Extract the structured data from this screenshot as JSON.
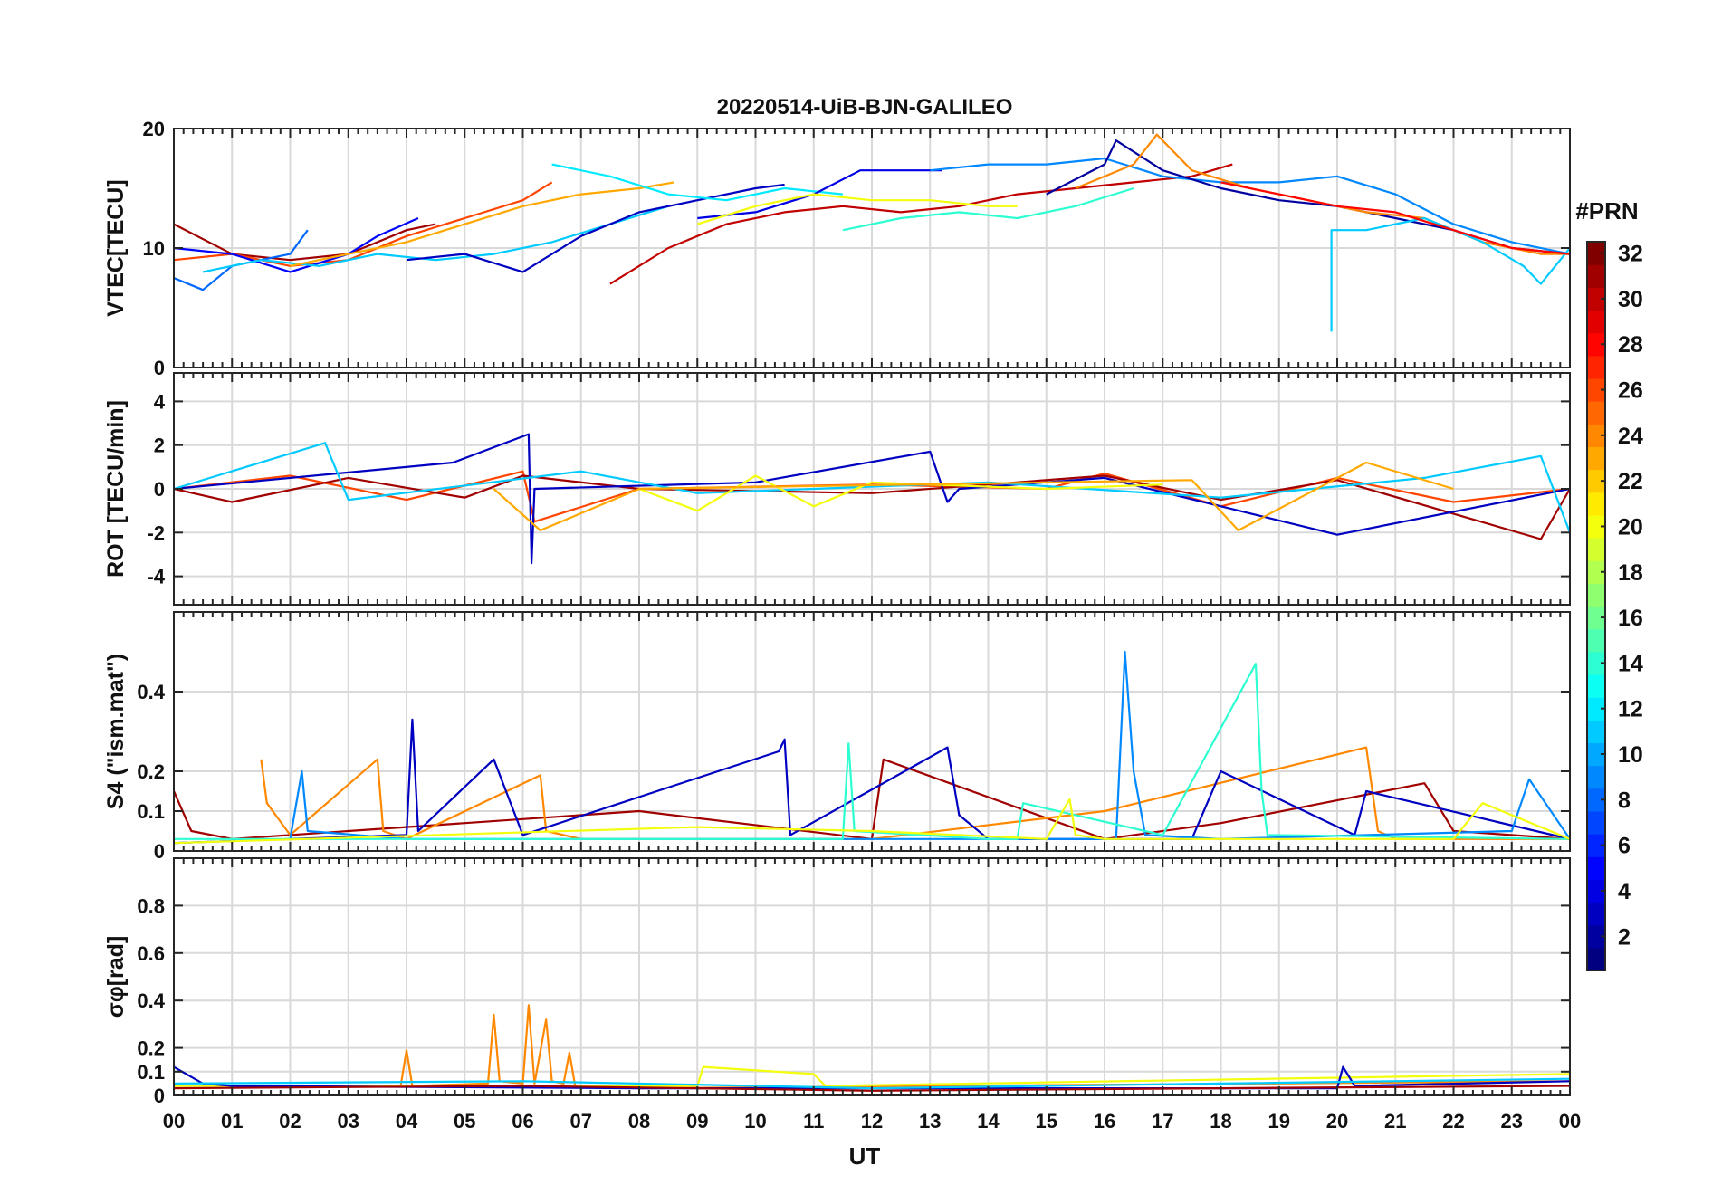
{
  "figure_title": "20220514-UiB-BJN-GALILEO",
  "x_axis": {
    "label": "UT",
    "ticks": [
      "00",
      "01",
      "02",
      "03",
      "04",
      "05",
      "06",
      "07",
      "08",
      "09",
      "10",
      "11",
      "12",
      "13",
      "14",
      "15",
      "16",
      "17",
      "18",
      "19",
      "20",
      "21",
      "22",
      "23",
      "00"
    ],
    "range": [
      0,
      24
    ]
  },
  "colorbar": {
    "title": "#PRN",
    "range": [
      1,
      32
    ],
    "ticks": [
      2,
      4,
      6,
      8,
      10,
      12,
      14,
      16,
      18,
      20,
      22,
      24,
      26,
      28,
      30,
      32
    ],
    "colormap": "jet"
  },
  "chart_data": [
    {
      "type": "line",
      "title": "20220514-UiB-BJN-GALILEO",
      "xlabel": "UT",
      "ylabel": "VTEC[TECU]",
      "ylim": [
        0,
        20
      ],
      "yticks": [
        0,
        10,
        20
      ],
      "grid": true,
      "series": [
        {
          "prn": 31,
          "x": [
            0,
            1,
            2,
            3,
            4,
            4.5
          ],
          "y": [
            12,
            9.5,
            9,
            9.5,
            11.5,
            12
          ]
        },
        {
          "prn": 26,
          "x": [
            0,
            1,
            2,
            3,
            4,
            5,
            6,
            6.5
          ],
          "y": [
            9,
            9.5,
            8.5,
            9,
            11,
            12.5,
            14,
            15.5
          ]
        },
        {
          "prn": 8,
          "x": [
            0,
            0.5,
            1,
            2,
            2.3
          ],
          "y": [
            7.5,
            6.5,
            8.5,
            9.5,
            11.5
          ]
        },
        {
          "prn": 5,
          "x": [
            0,
            1,
            2,
            3,
            3.5,
            4.2
          ],
          "y": [
            10,
            9.5,
            8,
            9.5,
            11,
            12.5
          ]
        },
        {
          "prn": 11,
          "x": [
            0.5,
            1.5,
            2.5,
            3.5,
            4.5,
            5.5,
            6.5,
            7.5,
            8.5
          ],
          "y": [
            8,
            9,
            8.5,
            9.5,
            9,
            9.5,
            10.5,
            12,
            13.5
          ]
        },
        {
          "prn": 23,
          "x": [
            2,
            3,
            4,
            5,
            6,
            7,
            8,
            8.6
          ],
          "y": [
            8.5,
            9.5,
            10.5,
            12,
            13.5,
            14.5,
            15,
            15.5
          ]
        },
        {
          "prn": 3,
          "x": [
            4,
            5,
            6,
            7,
            8,
            9,
            10,
            10.5
          ],
          "y": [
            9,
            9.5,
            8,
            11,
            13,
            14,
            15,
            15.3
          ]
        },
        {
          "prn": 12,
          "x": [
            6.5,
            7.5,
            8.5,
            9.5,
            10.5,
            11.5
          ],
          "y": [
            17,
            16,
            14.5,
            14,
            15,
            14.5
          ]
        },
        {
          "prn": 30,
          "x": [
            7.5,
            8.5,
            9.5,
            10.5,
            11.5,
            12.5,
            13.5,
            14.5,
            15.5,
            16.5,
            17.5,
            18.2
          ],
          "y": [
            7,
            10,
            12,
            13,
            13.5,
            13,
            13.5,
            14.5,
            15,
            15.5,
            16,
            17
          ]
        },
        {
          "prn": 4,
          "x": [
            9,
            10,
            11,
            11.8,
            12.5,
            13.2
          ],
          "y": [
            12.5,
            13,
            14.5,
            16.5,
            16.5,
            16.5
          ]
        },
        {
          "prn": 20,
          "x": [
            9,
            10,
            11,
            12,
            13,
            14,
            14.5
          ],
          "y": [
            12,
            13.5,
            14.5,
            14,
            14,
            13.5,
            13.5
          ]
        },
        {
          "prn": 14,
          "x": [
            11.5,
            12.5,
            13.5,
            14.5,
            15.5,
            16.5
          ],
          "y": [
            11.5,
            12.5,
            13,
            12.5,
            13.5,
            15
          ]
        },
        {
          "prn": 9,
          "x": [
            13,
            14,
            15,
            16,
            17,
            18,
            19,
            20,
            21,
            22,
            23,
            24
          ],
          "y": [
            16.5,
            17,
            17,
            17.5,
            16,
            15.5,
            15.5,
            16,
            14.5,
            12,
            10.5,
            9.5
          ]
        },
        {
          "prn": 2,
          "x": [
            15,
            16,
            16.2,
            17,
            18,
            19,
            20,
            21,
            22,
            23,
            24
          ],
          "y": [
            14.5,
            17,
            19,
            16.5,
            15,
            14,
            13.5,
            12.5,
            11.5,
            10,
            9.5
          ]
        },
        {
          "prn": 24,
          "x": [
            15.5,
            16.5,
            16.9,
            17.5,
            18.5,
            19.5,
            20.5,
            21.5,
            22.5,
            23.5,
            24
          ],
          "y": [
            15,
            17,
            19.5,
            16.5,
            15,
            14,
            13,
            12.5,
            10.5,
            9.5,
            9.5
          ]
        },
        {
          "prn": 11,
          "x": [
            19.9,
            19.9,
            20.5,
            21.5,
            22.5,
            23.2,
            23.5,
            24
          ],
          "y": [
            3,
            11.5,
            11.5,
            12.5,
            10.5,
            8.5,
            7,
            10
          ]
        },
        {
          "prn": 28,
          "x": [
            18,
            19,
            20,
            21,
            22,
            23,
            24
          ],
          "y": [
            15.5,
            14.5,
            13.5,
            13,
            11.5,
            10,
            9.5
          ]
        }
      ]
    },
    {
      "type": "line",
      "ylabel": "ROT [TECU/min]",
      "ylim": [
        -5.3,
        5.3
      ],
      "yticks": [
        -4,
        -2,
        0,
        2,
        4
      ],
      "grid": true,
      "series": [
        {
          "prn": 26,
          "x": [
            0,
            2,
            4,
            6,
            6.2,
            8,
            12,
            15,
            16,
            18,
            20,
            22,
            24
          ],
          "y": [
            0,
            0.6,
            -0.5,
            0.8,
            -1.5,
            0,
            0.2,
            0,
            0.7,
            -0.8,
            0.5,
            -0.6,
            0
          ]
        },
        {
          "prn": 31,
          "x": [
            0,
            1,
            3,
            5,
            6,
            8,
            12,
            16,
            18,
            20,
            23.5,
            24
          ],
          "y": [
            0,
            -0.6,
            0.5,
            -0.4,
            0.6,
            0,
            -0.2,
            0.6,
            -0.5,
            0.4,
            -2.3,
            0
          ]
        },
        {
          "prn": 3,
          "x": [
            0,
            4.8,
            6.1,
            6.15,
            6.2,
            10,
            13,
            13.3,
            13.5,
            16,
            20,
            24
          ],
          "y": [
            0,
            1.2,
            2.5,
            -3.4,
            0,
            0.3,
            1.7,
            -0.6,
            0,
            0.5,
            -2.1,
            0
          ]
        },
        {
          "prn": 11,
          "x": [
            0,
            2.6,
            3,
            7,
            9,
            14,
            18,
            21.5,
            23.5,
            24
          ],
          "y": [
            0,
            2.1,
            -0.5,
            0.8,
            -0.2,
            0.3,
            -0.4,
            0.5,
            1.5,
            -2
          ]
        },
        {
          "prn": 20,
          "x": [
            8,
            9,
            10,
            11,
            12,
            15,
            17
          ],
          "y": [
            0,
            -1,
            0.6,
            -0.8,
            0.3,
            0,
            0.2
          ]
        },
        {
          "prn": 23,
          "x": [
            5.5,
            6.3,
            8,
            17.5,
            18.3,
            20.5,
            22
          ],
          "y": [
            0,
            -1.9,
            0,
            0.4,
            -1.9,
            1.2,
            0
          ]
        }
      ]
    },
    {
      "type": "line",
      "ylabel": "S4 (\"ism.mat\")",
      "ylim": [
        0,
        0.6
      ],
      "yticks": [
        0,
        0.1,
        0.2,
        0.4
      ],
      "grid": true,
      "series": [
        {
          "prn": 31,
          "x": [
            0,
            0.3,
            1,
            4,
            8,
            12,
            12.2,
            16,
            18,
            21.5,
            22,
            24
          ],
          "y": [
            0.15,
            0.05,
            0.03,
            0.06,
            0.1,
            0.03,
            0.23,
            0.03,
            0.07,
            0.17,
            0.05,
            0.03
          ]
        },
        {
          "prn": 24,
          "x": [
            1.5,
            1.6,
            2,
            3.5,
            3.6,
            4,
            6.3,
            6.4,
            7,
            12,
            16,
            20.5,
            20.7,
            21,
            24
          ],
          "y": [
            0.23,
            0.12,
            0.04,
            0.23,
            0.05,
            0.03,
            0.19,
            0.05,
            0.03,
            0.03,
            0.1,
            0.26,
            0.05,
            0.03,
            0.03
          ]
        },
        {
          "prn": 3,
          "x": [
            0,
            4,
            4.1,
            4.2,
            5.5,
            6,
            10.4,
            10.5,
            10.6,
            13.3,
            13.5,
            14,
            17.5,
            18,
            20.3,
            20.5,
            24
          ],
          "y": [
            0.02,
            0.04,
            0.33,
            0.05,
            0.23,
            0.04,
            0.25,
            0.28,
            0.04,
            0.26,
            0.09,
            0.03,
            0.03,
            0.2,
            0.04,
            0.15,
            0.03
          ]
        },
        {
          "prn": 9,
          "x": [
            0,
            2,
            2.2,
            2.3,
            4,
            16.2,
            16.35,
            16.5,
            16.7,
            18,
            23,
            23.3,
            24
          ],
          "y": [
            0.02,
            0.03,
            0.2,
            0.05,
            0.03,
            0.03,
            0.5,
            0.2,
            0.04,
            0.03,
            0.05,
            0.18,
            0.03
          ]
        },
        {
          "prn": 14,
          "x": [
            0,
            11.5,
            11.6,
            11.7,
            14,
            14.5,
            14.6,
            17,
            18.6,
            18.7,
            18.8,
            24
          ],
          "y": [
            0.03,
            0.03,
            0.27,
            0.05,
            0.03,
            0.03,
            0.12,
            0.04,
            0.47,
            0.15,
            0.04,
            0.03
          ]
        },
        {
          "prn": 20,
          "x": [
            0,
            9,
            12,
            15,
            15.4,
            15.5,
            16,
            22,
            22.5,
            24
          ],
          "y": [
            0.02,
            0.06,
            0.05,
            0.03,
            0.13,
            0.04,
            0.03,
            0.03,
            0.12,
            0.03
          ]
        }
      ]
    },
    {
      "type": "line",
      "ylabel": "σφ[rad]",
      "ylim": [
        0,
        1
      ],
      "yticks": [
        0,
        0.1,
        0.2,
        0.4,
        0.6,
        0.8
      ],
      "grid": true,
      "series": [
        {
          "prn": 24,
          "x": [
            0,
            3.9,
            4,
            4.1,
            5.4,
            5.5,
            5.6,
            6,
            6.1,
            6.2,
            6.4,
            6.5,
            6.7,
            6.8,
            6.9,
            8,
            24
          ],
          "y": [
            0.04,
            0.04,
            0.19,
            0.04,
            0.05,
            0.34,
            0.06,
            0.05,
            0.38,
            0.05,
            0.32,
            0.06,
            0.05,
            0.18,
            0.04,
            0.03,
            0.06
          ]
        },
        {
          "prn": 20,
          "x": [
            0,
            9,
            9.1,
            11,
            11.2,
            24
          ],
          "y": [
            0.04,
            0.04,
            0.12,
            0.09,
            0.04,
            0.09
          ]
        },
        {
          "prn": 3,
          "x": [
            0,
            0.5,
            1,
            8,
            20,
            20.1,
            20.3,
            24
          ],
          "y": [
            0.12,
            0.05,
            0.04,
            0.03,
            0.03,
            0.12,
            0.04,
            0.06
          ]
        },
        {
          "prn": 11,
          "x": [
            0,
            6,
            12,
            18,
            24
          ],
          "y": [
            0.05,
            0.06,
            0.03,
            0.05,
            0.07
          ]
        },
        {
          "prn": 31,
          "x": [
            0,
            6,
            12,
            18,
            24
          ],
          "y": [
            0.03,
            0.04,
            0.02,
            0.03,
            0.04
          ]
        }
      ]
    }
  ]
}
